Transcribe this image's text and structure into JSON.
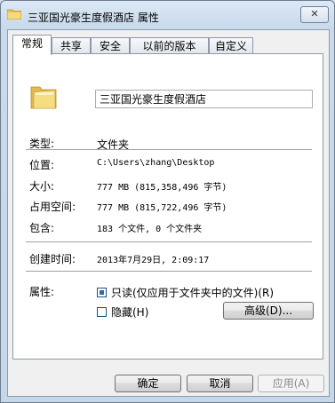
{
  "window": {
    "title": "三亚国光豪生度假酒店 属性"
  },
  "close": {
    "glyph": "✕"
  },
  "tabs": [
    {
      "label": "常规"
    },
    {
      "label": "共享"
    },
    {
      "label": "安全"
    },
    {
      "label": "以前的版本"
    },
    {
      "label": "自定义"
    }
  ],
  "file": {
    "name": "三亚国光豪生度假酒店"
  },
  "rows": {
    "type": {
      "label": "类型:",
      "value": "文件夹"
    },
    "location": {
      "label": "位置:",
      "value": "C:\\Users\\zhang\\Desktop"
    },
    "size": {
      "label": "大小:",
      "value": "777 MB (815,358,496 字节)"
    },
    "size_on_disk": {
      "label": "占用空间:",
      "value": "777 MB (815,722,496 字节)"
    },
    "contains": {
      "label": "包含:",
      "value": "183 个文件, 0 个文件夹"
    },
    "created": {
      "label": "创建时间:",
      "value": "2013年7月29日, 2:09:17"
    }
  },
  "attributes": {
    "label": "属性:",
    "readonly_label": "只读(仅应用于文件夹中的文件)(R)",
    "hidden_label": "隐藏(H)",
    "advanced_label": "高级(D)..."
  },
  "buttons": {
    "ok": "确定",
    "cancel": "取消",
    "apply": "应用(A)"
  },
  "colors": {
    "folder": "#f3d270",
    "accent": "#2f69b1"
  }
}
